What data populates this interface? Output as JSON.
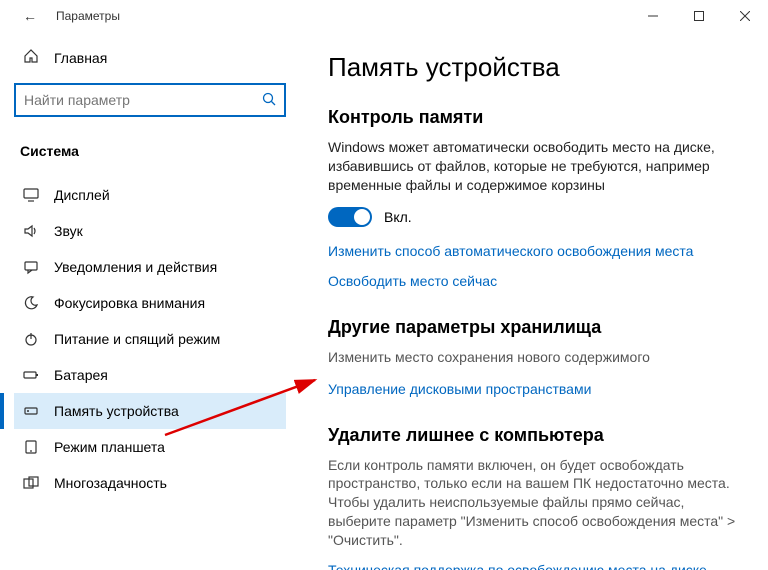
{
  "titlebar": {
    "back_icon": "←",
    "title": "Параметры"
  },
  "sidebar": {
    "home_label": "Главная",
    "search_placeholder": "Найти параметр",
    "section_title": "Система",
    "items": [
      {
        "icon": "display",
        "label": "Дисплей"
      },
      {
        "icon": "sound",
        "label": "Звук"
      },
      {
        "icon": "notif",
        "label": "Уведомления и действия"
      },
      {
        "icon": "focus",
        "label": "Фокусировка внимания"
      },
      {
        "icon": "power",
        "label": "Питание и спящий режим"
      },
      {
        "icon": "battery",
        "label": "Батарея"
      },
      {
        "icon": "storage",
        "label": "Память устройства",
        "active": true
      },
      {
        "icon": "tablet",
        "label": "Режим планшета"
      },
      {
        "icon": "multi",
        "label": "Многозадачность"
      }
    ]
  },
  "content": {
    "page_title": "Память устройства",
    "storage_sense": {
      "title": "Контроль памяти",
      "desc": "Windows может автоматически освободить место на диске, избавившись от файлов, которые не требуются, например временные файлы и содержимое корзины",
      "toggle_label": "Вкл.",
      "link1": "Изменить способ автоматического освобождения места",
      "link2": "Освободить место сейчас"
    },
    "other": {
      "title": "Другие параметры хранилища",
      "link1": "Изменить место сохранения нового содержимого",
      "link2": "Управление дисковыми пространствами"
    },
    "cleanup": {
      "title": "Удалите лишнее с компьютера",
      "desc": "Если контроль памяти включен, он будет освобождать пространство, только если на вашем ПК недостаточно места. Чтобы удалить неиспользуемые файлы прямо сейчас, выберите параметр \"Изменить способ освобождения места\" > \"Очистить\".",
      "link": "Техническая поддержка по освобождению места на диске"
    }
  },
  "icons": {
    "home": "⌂",
    "search": "🔍",
    "display": "🖵",
    "sound": "🔈",
    "notif": "💬",
    "focus": "☾",
    "power": "⏻",
    "battery": "▭",
    "storage": "�işki",
    "tablet": "▢",
    "multi": "⧉"
  }
}
